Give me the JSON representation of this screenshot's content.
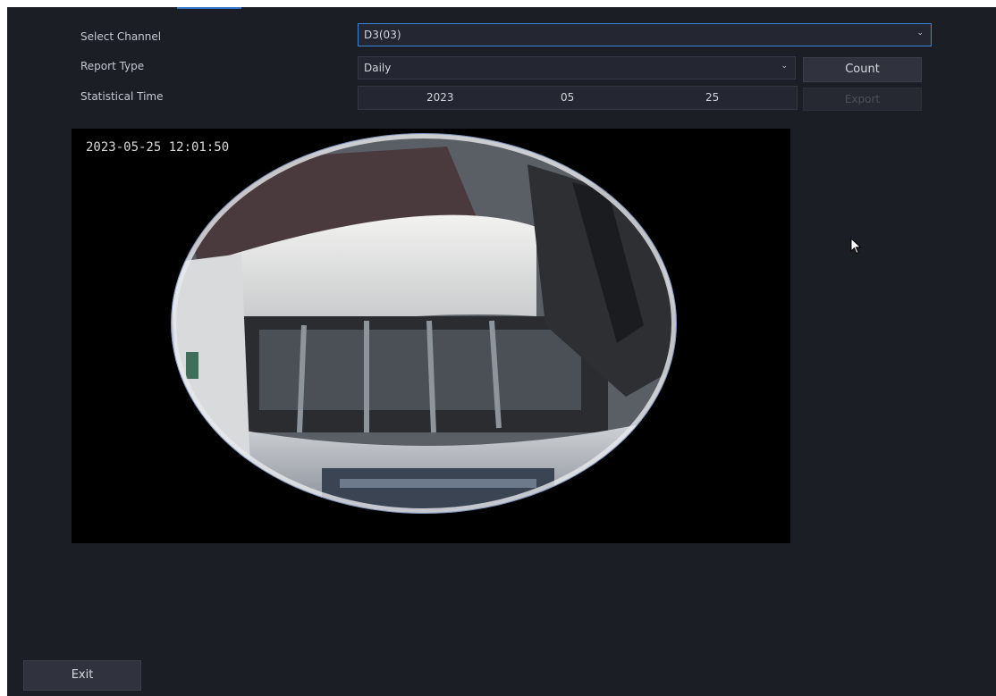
{
  "form": {
    "select_channel": {
      "label": "Select Channel",
      "value": "D3(03)"
    },
    "report_type": {
      "label": "Report Type",
      "value": "Daily"
    },
    "statistical_time": {
      "label": "Statistical Time",
      "year": "2023",
      "month": "05",
      "day": "25"
    }
  },
  "buttons": {
    "count": "Count",
    "export": "Export",
    "exit": "Exit"
  },
  "video": {
    "osd_timestamp": "2023-05-25 12:01:50"
  },
  "icons": {
    "dropdown": "chevron-down-icon",
    "cursor": "mouse-pointer-icon"
  },
  "colors": {
    "background": "#1c1e26",
    "field": "#242731",
    "focus_border": "#3b84d8",
    "button": "#30333e"
  }
}
